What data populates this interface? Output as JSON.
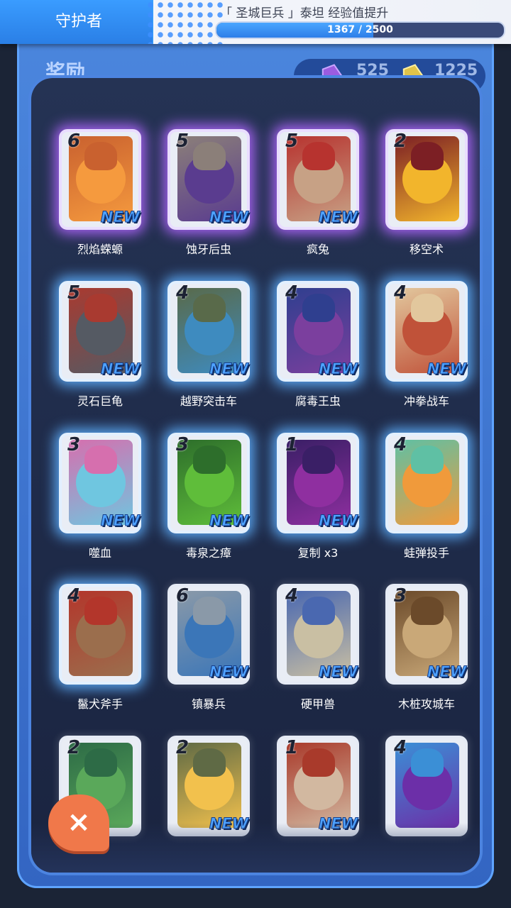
{
  "header": {
    "role_title": "守护者",
    "upgrade_text": "「 圣城巨兵 」泰坦 经验值提升",
    "xp_current": 1367,
    "xp_max": 2500,
    "xp_label": "1367 / 2500",
    "xp_fraction": 0.5468
  },
  "panel": {
    "title": "奖励",
    "currency": [
      {
        "icon": "purple-gem-icon",
        "value": "525"
      },
      {
        "icon": "gold-gem-icon",
        "value": "1225"
      }
    ]
  },
  "cards": [
    {
      "name": "烈焰蝾螈",
      "cost": "6",
      "new": "NEW",
      "rarity": "purple",
      "colors": [
        "#f59a3e",
        "#c9612f"
      ]
    },
    {
      "name": "蚀牙后虫",
      "cost": "5",
      "new": "NEW",
      "rarity": "purple",
      "colors": [
        "#5a3c8f",
        "#8b7f79"
      ]
    },
    {
      "name": "疯兔",
      "cost": "5",
      "new": "NEW",
      "rarity": "purple",
      "colors": [
        "#c7a185",
        "#b7332f"
      ]
    },
    {
      "name": "移空术",
      "cost": "2",
      "new": "",
      "rarity": "purple",
      "colors": [
        "#f2b52c",
        "#7c1f24"
      ]
    },
    {
      "name": "灵石巨龟",
      "cost": "5",
      "new": "NEW",
      "rarity": "blue",
      "colors": [
        "#555a63",
        "#a93a30"
      ]
    },
    {
      "name": "越野突击车",
      "cost": "4",
      "new": "NEW",
      "rarity": "blue",
      "colors": [
        "#3e8bbf",
        "#596a4a"
      ]
    },
    {
      "name": "腐毒王虫",
      "cost": "4",
      "new": "NEW",
      "rarity": "blue",
      "colors": [
        "#7b3f9e",
        "#2f3f8f"
      ]
    },
    {
      "name": "冲拳战车",
      "cost": "4",
      "new": "NEW",
      "rarity": "blue",
      "colors": [
        "#c05239",
        "#e2c79d"
      ]
    },
    {
      "name": "噬血",
      "cost": "3",
      "new": "NEW",
      "rarity": "blue",
      "colors": [
        "#6fc6e0",
        "#d66fae"
      ]
    },
    {
      "name": "毒泉之瘴",
      "cost": "3",
      "new": "NEW",
      "rarity": "blue",
      "colors": [
        "#5fbd3a",
        "#2d6e2b"
      ]
    },
    {
      "name": "复制 x3",
      "cost": "1",
      "new": "NEW",
      "rarity": "blue",
      "colors": [
        "#8f2fa0",
        "#3a1f66"
      ]
    },
    {
      "name": "蛙弹投手",
      "cost": "4",
      "new": "",
      "rarity": "blue",
      "colors": [
        "#f09a3b",
        "#5fc0a4"
      ]
    },
    {
      "name": "鬣犬斧手",
      "cost": "4",
      "new": "",
      "rarity": "blue",
      "colors": [
        "#9b6e4d",
        "#b3362b"
      ]
    },
    {
      "name": "镇暴兵",
      "cost": "6",
      "new": "NEW",
      "rarity": "plain",
      "colors": [
        "#3b76b8",
        "#8a99a8"
      ]
    },
    {
      "name": "硬甲兽",
      "cost": "4",
      "new": "NEW",
      "rarity": "plain",
      "colors": [
        "#c9bfa3",
        "#4a68b0"
      ]
    },
    {
      "name": "木桩攻城车",
      "cost": "3",
      "new": "NEW",
      "rarity": "plain",
      "colors": [
        "#c9a878",
        "#6b4a2a"
      ]
    },
    {
      "name": "",
      "cost": "2",
      "new": "",
      "rarity": "plain",
      "colors": [
        "#5aa85a",
        "#2d6b46"
      ]
    },
    {
      "name": "",
      "cost": "2",
      "new": "NEW",
      "rarity": "plain",
      "colors": [
        "#f2c14d",
        "#5f6a45"
      ]
    },
    {
      "name": "",
      "cost": "1",
      "new": "NEW",
      "rarity": "plain",
      "colors": [
        "#d2b8a0",
        "#a93a2b"
      ]
    },
    {
      "name": "",
      "cost": "4",
      "new": "",
      "rarity": "plain",
      "colors": [
        "#6c2fa8",
        "#3b8fd6"
      ]
    }
  ],
  "close_button": {
    "icon": "close-icon",
    "label": "×"
  }
}
